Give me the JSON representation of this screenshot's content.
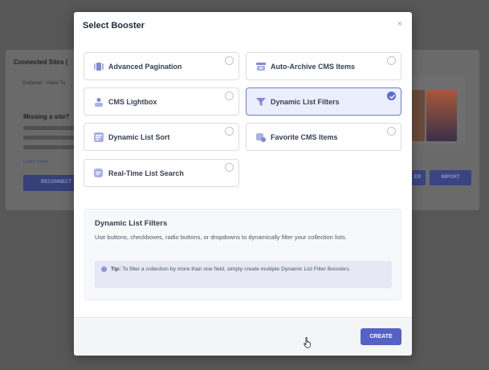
{
  "background": {
    "section_title": "Connected Sites (",
    "site_row": "Gotboost - Video Tu",
    "missing_title": "Missing a site?",
    "learn_more": "Learn more",
    "reconnect_label": "RECONNECT",
    "import_label": "IMPORT",
    "filter_label": "ER"
  },
  "modal": {
    "title": "Select Booster",
    "close": "×",
    "boosters": [
      {
        "label": "Advanced Pagination",
        "icon": "pagination-icon",
        "selected": false
      },
      {
        "label": "Auto-Archive CMS Items",
        "icon": "archive-icon",
        "selected": false
      },
      {
        "label": "CMS Lightbox",
        "icon": "lightbox-icon",
        "selected": false
      },
      {
        "label": "Dynamic List Filters",
        "icon": "filter-icon",
        "selected": true
      },
      {
        "label": "Dynamic List Sort",
        "icon": "sort-icon",
        "selected": false
      },
      {
        "label": "Favorite CMS Items",
        "icon": "favorite-icon",
        "selected": false
      },
      {
        "label": "Real-Time List Search",
        "icon": "search-icon",
        "selected": false
      }
    ],
    "description": {
      "title": "Dynamic List Filters",
      "text": "Use buttons, checkboxes, radio buttons, or dropdowns to dynamically filter your collection lists.",
      "tip_label": "Tip:",
      "tip_text": "To filter a collection by more than one field, simply create multiple Dynamic List Filter Boosters."
    },
    "create_label": "CREATE"
  },
  "colors": {
    "accent": "#5562c5",
    "selected_bg": "#ebeefc",
    "icon": "#7f8ad6"
  }
}
